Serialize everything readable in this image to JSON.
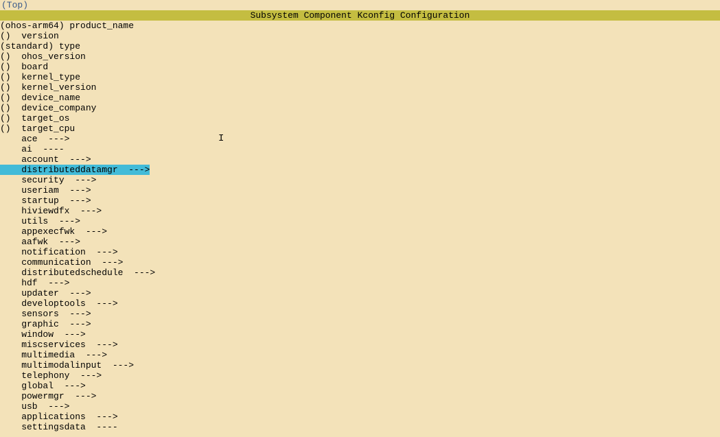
{
  "top_label": "(Top)",
  "title": "Subsystem Component Kconfig Configuration",
  "items": [
    {
      "prefix": "(ohos-arm64) ",
      "label": "product_name",
      "suffix": "",
      "highlighted": false
    },
    {
      "prefix": "()  ",
      "label": "version",
      "suffix": "",
      "highlighted": false
    },
    {
      "prefix": "(standard) ",
      "label": "type",
      "suffix": "",
      "highlighted": false
    },
    {
      "prefix": "()  ",
      "label": "ohos_version",
      "suffix": "",
      "highlighted": false
    },
    {
      "prefix": "()  ",
      "label": "board",
      "suffix": "",
      "highlighted": false
    },
    {
      "prefix": "()  ",
      "label": "kernel_type",
      "suffix": "",
      "highlighted": false
    },
    {
      "prefix": "()  ",
      "label": "kernel_version",
      "suffix": "",
      "highlighted": false
    },
    {
      "prefix": "()  ",
      "label": "device_name",
      "suffix": "",
      "highlighted": false
    },
    {
      "prefix": "()  ",
      "label": "device_company",
      "suffix": "",
      "highlighted": false
    },
    {
      "prefix": "()  ",
      "label": "target_os",
      "suffix": "",
      "highlighted": false
    },
    {
      "prefix": "()  ",
      "label": "target_cpu",
      "suffix": "",
      "highlighted": false
    },
    {
      "prefix": "    ",
      "label": "ace",
      "suffix": "  --->",
      "highlighted": false
    },
    {
      "prefix": "    ",
      "label": "ai",
      "suffix": "  ----",
      "highlighted": false
    },
    {
      "prefix": "    ",
      "label": "account",
      "suffix": "  --->",
      "highlighted": false
    },
    {
      "prefix": "    ",
      "label": "distributeddatamgr",
      "suffix": "  --->",
      "highlighted": true
    },
    {
      "prefix": "    ",
      "label": "security",
      "suffix": "  --->",
      "highlighted": false
    },
    {
      "prefix": "    ",
      "label": "useriam",
      "suffix": "  --->",
      "highlighted": false
    },
    {
      "prefix": "    ",
      "label": "startup",
      "suffix": "  --->",
      "highlighted": false
    },
    {
      "prefix": "    ",
      "label": "hiviewdfx",
      "suffix": "  --->",
      "highlighted": false
    },
    {
      "prefix": "    ",
      "label": "utils",
      "suffix": "  --->",
      "highlighted": false
    },
    {
      "prefix": "    ",
      "label": "appexecfwk",
      "suffix": "  --->",
      "highlighted": false
    },
    {
      "prefix": "    ",
      "label": "aafwk",
      "suffix": "  --->",
      "highlighted": false
    },
    {
      "prefix": "    ",
      "label": "notification",
      "suffix": "  --->",
      "highlighted": false
    },
    {
      "prefix": "    ",
      "label": "communication",
      "suffix": "  --->",
      "highlighted": false
    },
    {
      "prefix": "    ",
      "label": "distributedschedule",
      "suffix": "  --->",
      "highlighted": false
    },
    {
      "prefix": "    ",
      "label": "hdf",
      "suffix": "  --->",
      "highlighted": false
    },
    {
      "prefix": "    ",
      "label": "updater",
      "suffix": "  --->",
      "highlighted": false
    },
    {
      "prefix": "    ",
      "label": "developtools",
      "suffix": "  --->",
      "highlighted": false
    },
    {
      "prefix": "    ",
      "label": "sensors",
      "suffix": "  --->",
      "highlighted": false
    },
    {
      "prefix": "    ",
      "label": "graphic",
      "suffix": "  --->",
      "highlighted": false
    },
    {
      "prefix": "    ",
      "label": "window",
      "suffix": "  --->",
      "highlighted": false
    },
    {
      "prefix": "    ",
      "label": "miscservices",
      "suffix": "  --->",
      "highlighted": false
    },
    {
      "prefix": "    ",
      "label": "multimedia",
      "suffix": "  --->",
      "highlighted": false
    },
    {
      "prefix": "    ",
      "label": "multimodalinput",
      "suffix": "  --->",
      "highlighted": false
    },
    {
      "prefix": "    ",
      "label": "telephony",
      "suffix": "  --->",
      "highlighted": false
    },
    {
      "prefix": "    ",
      "label": "global",
      "suffix": "  --->",
      "highlighted": false
    },
    {
      "prefix": "    ",
      "label": "powermgr",
      "suffix": "  --->",
      "highlighted": false
    },
    {
      "prefix": "    ",
      "label": "usb",
      "suffix": "  --->",
      "highlighted": false
    },
    {
      "prefix": "    ",
      "label": "applications",
      "suffix": "  --->",
      "highlighted": false
    },
    {
      "prefix": "    ",
      "label": "settingsdata",
      "suffix": "  ----",
      "highlighted": false
    }
  ],
  "cursor_char": "I"
}
